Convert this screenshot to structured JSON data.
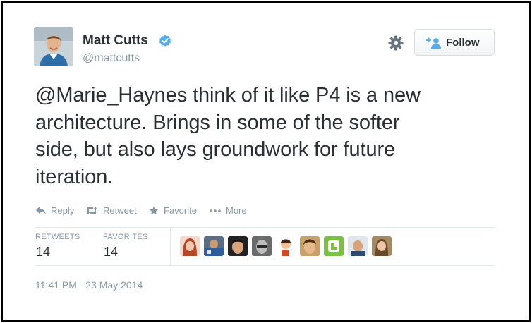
{
  "user": {
    "name": "Matt Cutts",
    "handle": "@mattcutts",
    "verified": true
  },
  "follow_button": {
    "label": "Follow",
    "icon": "add-user-icon"
  },
  "settings_icon": "gear-icon",
  "tweet": {
    "lines": [
      "@Marie_Haynes think of it like P4 is a new",
      "architecture. Brings in some of the softer",
      "side, but also lays groundwork for future",
      "iteration."
    ]
  },
  "actions": {
    "reply": "Reply",
    "retweet": "Retweet",
    "favorite": "Favorite",
    "more": "More"
  },
  "stats": {
    "retweets_label": "RETWEETS",
    "retweets_count": "14",
    "favorites_label": "FAVORITES",
    "favorites_count": "14"
  },
  "favoriters_count_shown": 9,
  "timestamp": "11:41 PM - 23 May 2014",
  "colors": {
    "text": "#292f33",
    "muted": "#8899a6",
    "verified_blue": "#55acee",
    "divider": "#e1e8ed"
  }
}
